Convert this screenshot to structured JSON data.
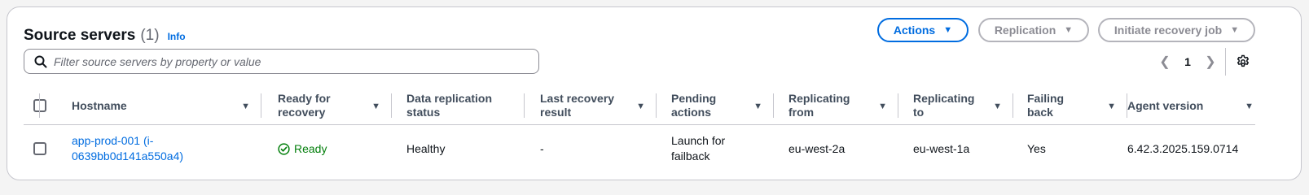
{
  "header": {
    "title": "Source servers",
    "count": "(1)",
    "info_label": "Info"
  },
  "buttons": {
    "actions": "Actions",
    "replication": "Replication",
    "initiate_recovery": "Initiate recovery job"
  },
  "search": {
    "placeholder": "Filter source servers by property or value",
    "value": ""
  },
  "pagination": {
    "current_page": "1"
  },
  "table": {
    "columns": [
      "Hostname",
      "Ready for recovery",
      "Data replication status",
      "Last recovery result",
      "Pending actions",
      "Replicating from",
      "Replicating to",
      "Failing back",
      "Agent version"
    ],
    "rows": [
      {
        "hostname": "app-prod-001 (i-0639bb0d141a550a4)",
        "ready_for_recovery": "Ready",
        "data_replication_status": "Healthy",
        "last_recovery_result": "-",
        "pending_actions": "Launch for failback",
        "replicating_from": "eu-west-2a",
        "replicating_to": "eu-west-1a",
        "failing_back": "Yes",
        "agent_version": "6.42.3.2025.159.0714"
      }
    ]
  },
  "colors": {
    "link": "#006ce0",
    "success": "#037f0c",
    "border": "#c6c6cd"
  }
}
